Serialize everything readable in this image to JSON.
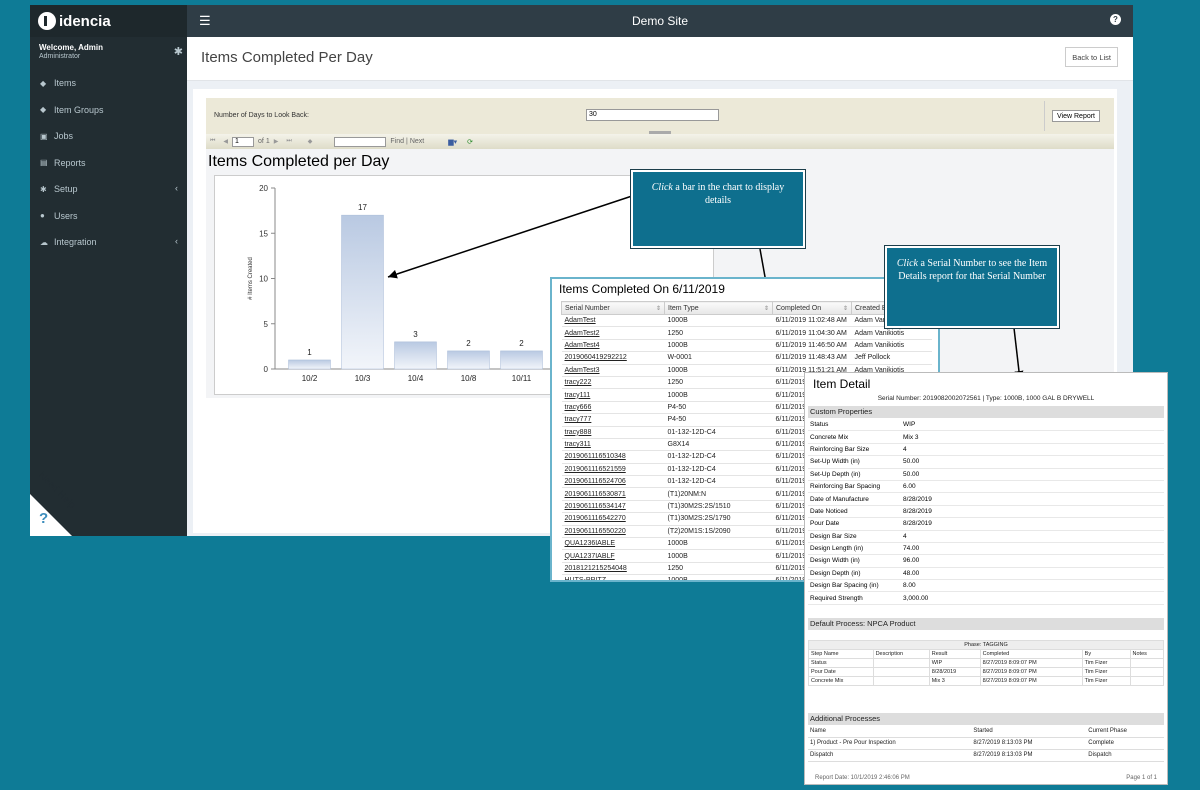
{
  "app": {
    "brand": "idencia",
    "site_title": "Demo Site",
    "user": {
      "welcome": "Welcome, Admin",
      "role": "Administrator"
    },
    "nav": [
      {
        "label": "Items",
        "icon": "tag-icon",
        "glyph": "◆",
        "expandable": false
      },
      {
        "label": "Item Groups",
        "icon": "tags-icon",
        "glyph": "◆",
        "expandable": false
      },
      {
        "label": "Jobs",
        "icon": "copy-icon",
        "glyph": "▣",
        "expandable": false
      },
      {
        "label": "Reports",
        "icon": "chart-icon",
        "glyph": "▤",
        "expandable": false
      },
      {
        "label": "Setup",
        "icon": "cogs-icon",
        "glyph": "✱",
        "expandable": true
      },
      {
        "label": "Users",
        "icon": "users-icon",
        "glyph": "●",
        "expandable": false
      },
      {
        "label": "Integration",
        "icon": "cloud-icon",
        "glyph": "☁",
        "expandable": true
      }
    ],
    "need_help": "Need Help",
    "need_help_glyph": "?"
  },
  "page": {
    "title": "Items Completed Per Day",
    "back_button": "Back to List"
  },
  "report": {
    "param_label": "Number of Days to Look Back:",
    "param_value": "30",
    "view_report": "View Report",
    "toolbar": {
      "page_value": "1",
      "of_pages": "of 1",
      "find": "Find",
      "sep": "|",
      "next": "Next"
    }
  },
  "chart_data": {
    "type": "bar",
    "title": "Items Completed per Day",
    "ylabel": "# Items Created",
    "xlabel": "",
    "categories": [
      "10/2",
      "10/3",
      "10/4",
      "10/8",
      "10/11"
    ],
    "values": [
      1,
      17,
      3,
      2,
      2
    ],
    "ylim": [
      0,
      20
    ],
    "yticks": [
      0,
      5,
      10,
      15,
      20
    ],
    "bar_color": "#b9c9e2",
    "data_labels": true,
    "grid": false
  },
  "callouts": {
    "bar": {
      "em": "Click",
      "rest": " a bar in the chart to display details"
    },
    "serial": {
      "em": "Click",
      "rest": " a Serial Number to see the Item Details report for that Serial Number"
    }
  },
  "items_popup": {
    "title": "Items Completed On 6/11/2019",
    "columns": [
      "Serial Number",
      "Item Type",
      "Completed On",
      "Created By"
    ],
    "rows": [
      [
        "AdamTest",
        "1000B",
        "6/11/2019 11:02:48 AM",
        "Adam Vanikiotis"
      ],
      [
        "AdamTest2",
        "1250",
        "6/11/2019 11:04:30 AM",
        "Adam Vanikiotis"
      ],
      [
        "AdamTest4",
        "1000B",
        "6/11/2019 11:46:50 AM",
        "Adam Vanikiotis"
      ],
      [
        "2019060419292212",
        "W-0001",
        "6/11/2019 11:48:43 AM",
        "Jeff Pollock"
      ],
      [
        "AdamTest3",
        "1000B",
        "6/11/2019 11:51:21 AM",
        "Adam Vanikiotis"
      ],
      [
        "tracy222",
        "1250",
        "6/11/2019",
        ""
      ],
      [
        "tracy111",
        "1000B",
        "6/11/2019",
        ""
      ],
      [
        "tracy666",
        "P4-50",
        "6/11/2019",
        ""
      ],
      [
        "tracy777",
        "P4-50",
        "6/11/2019",
        ""
      ],
      [
        "tracy888",
        "01-132-12D-C4",
        "6/11/2019",
        ""
      ],
      [
        "tracy311",
        "G8X14",
        "6/11/2019",
        ""
      ],
      [
        "2019061116510348",
        "01-132-12D-C4",
        "6/11/2019",
        ""
      ],
      [
        "2019061116521559",
        "01-132-12D-C4",
        "6/11/2019",
        ""
      ],
      [
        "2019061116524706",
        "01-132-12D-C4",
        "6/11/2019",
        ""
      ],
      [
        "2019061116530871",
        "(T1)20NM:N",
        "6/11/2019",
        ""
      ],
      [
        "2019061116534147",
        "(T1)30M2S:2S/1510",
        "6/11/2019",
        ""
      ],
      [
        "2019061116542270",
        "(T1)30M2S:2S/1790",
        "6/11/2019",
        ""
      ],
      [
        "2019061116550220",
        "(T2)20M1S:1S/2090",
        "6/11/2019",
        ""
      ],
      [
        "QUA1236IABLE",
        "1000B",
        "6/11/2019",
        ""
      ],
      [
        "QUA1237IABLF",
        "1000B",
        "6/11/2019",
        ""
      ],
      [
        "2018121215254048",
        "1250",
        "6/11/2019",
        ""
      ],
      [
        "HUTS-PRITZ",
        "1000B",
        "6/11/2019",
        ""
      ]
    ]
  },
  "item_detail": {
    "title": "Item Detail",
    "subtitle": "Serial Number: 2019082002072561 | Type: 1000B, 1000 GAL B DRYWELL",
    "custom_properties_heading": "Custom Properties",
    "properties": [
      [
        "Status",
        "WIP"
      ],
      [
        "Concrete Mix",
        "Mix 3"
      ],
      [
        "Reinforcing Bar Size",
        "4"
      ],
      [
        "Set-Up Width (in)",
        "50.00"
      ],
      [
        "Set-Up Depth (in)",
        "50.00"
      ],
      [
        "Reinforcing Bar Spacing",
        "6.00"
      ],
      [
        "Date of Manufacture",
        "8/28/2019"
      ],
      [
        "Date Noticed",
        "8/28/2019"
      ],
      [
        "Pour Date",
        "8/28/2019"
      ],
      [
        "Design Bar Size",
        "4"
      ],
      [
        "Design Length (in)",
        "74.00"
      ],
      [
        "Design Width (in)",
        "96.00"
      ],
      [
        "Design Depth (in)",
        "48.00"
      ],
      [
        "Design Bar Spacing (in)",
        "8.00"
      ],
      [
        "Required Strength",
        "3,000.00"
      ]
    ],
    "default_process_heading": "Default Process: NPCA Product",
    "phase": "Phase: TAGGING",
    "process_columns": [
      "Step Name",
      "Description",
      "Result",
      "Completed",
      "By",
      "Notes"
    ],
    "process_rows": [
      [
        "Status",
        "",
        "WIP",
        "8/27/2019 8:09:07 PM",
        "Tim Fizer",
        ""
      ],
      [
        "Pour Date",
        "",
        "8/28/2019",
        "8/27/2019 8:09:07 PM",
        "Tim Fizer",
        ""
      ],
      [
        "Concrete Mix",
        "",
        "Mix 3",
        "8/27/2019 8:09:07 PM",
        "Tim Fizer",
        ""
      ]
    ],
    "additional_heading": "Additional Processes",
    "additional_columns": [
      "Name",
      "Started",
      "Current Phase"
    ],
    "additional_rows": [
      [
        "1) Product - Pre Pour Inspection",
        "8/27/2019 8:13:03 PM",
        "Complete"
      ],
      [
        "Dispatch",
        "8/27/2019 8:13:03 PM",
        "Dispatch"
      ]
    ],
    "report_date": "Report Date: 10/1/2019 2:46:06 PM",
    "page_of": "Page 1 of 1"
  },
  "colors": {
    "background": "#0e7b96",
    "sidebar": "#222d32",
    "topbar": "#2f3d46",
    "callout": "#0e6f8e",
    "bar": "#b9c9e2"
  }
}
